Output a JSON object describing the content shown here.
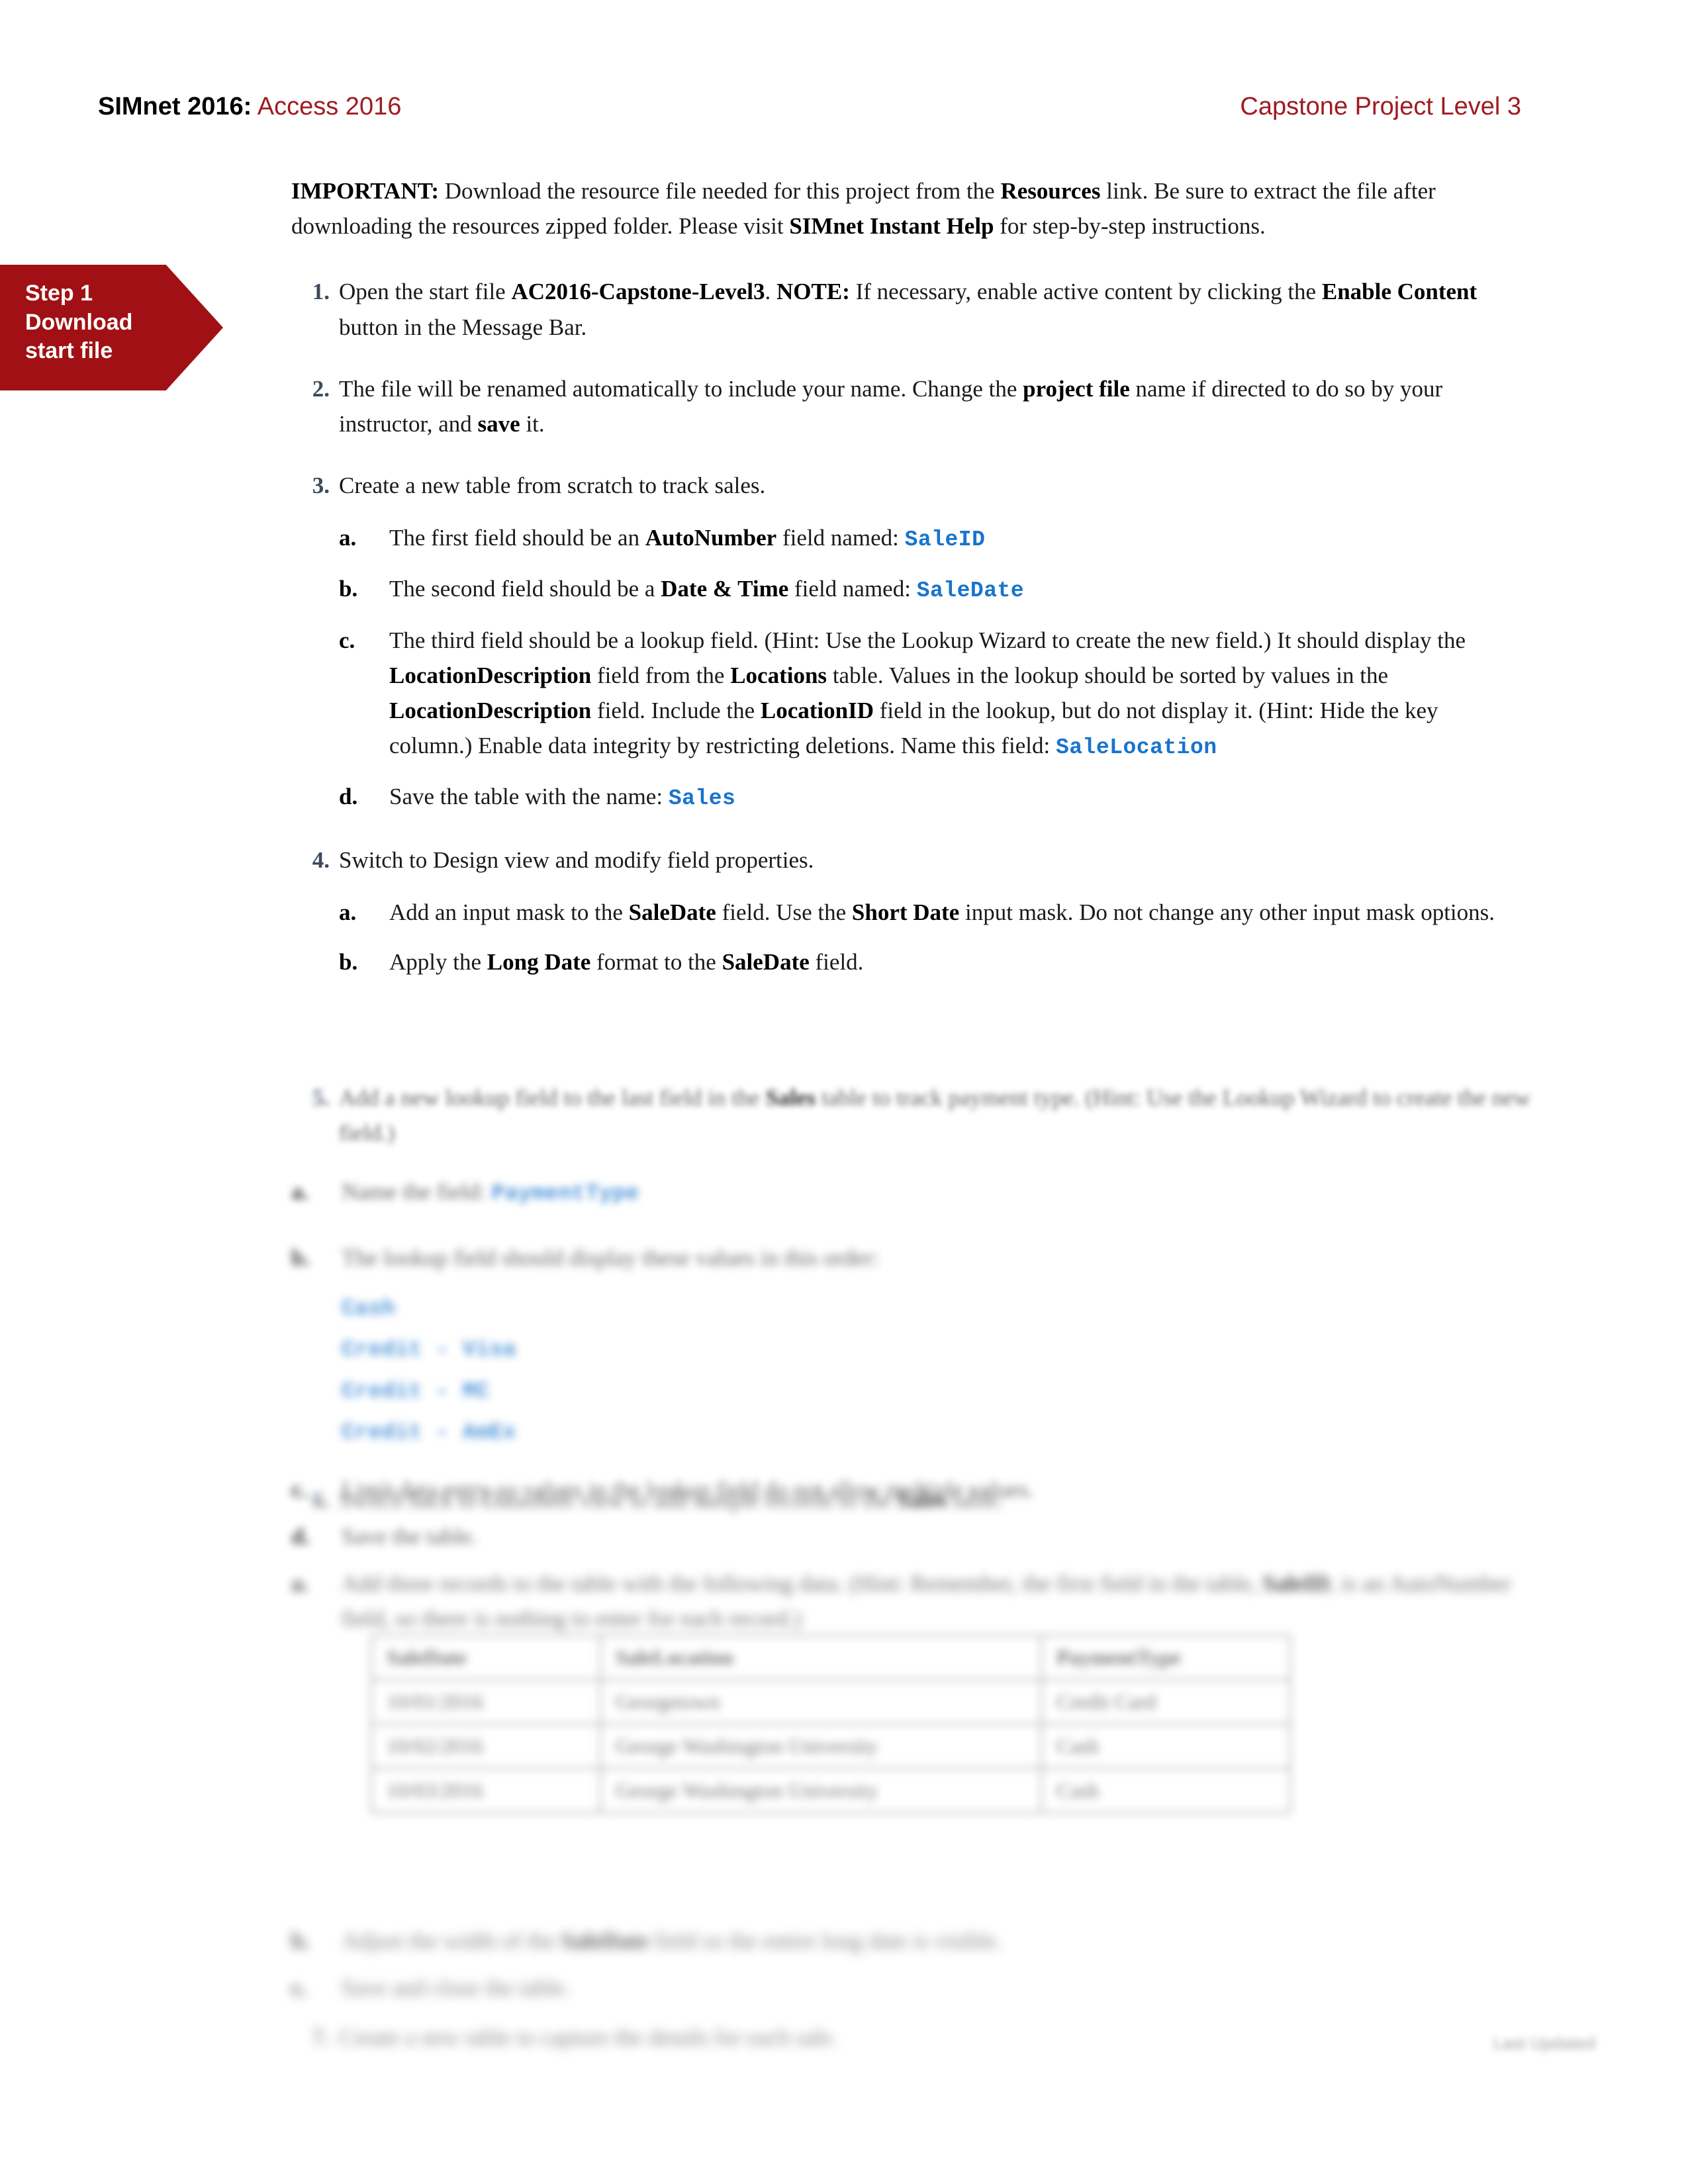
{
  "header": {
    "brand": "SIMnet 2016:",
    "product": " Access 2016",
    "right": "Capstone Project Level 3",
    "brand_color": "#000000",
    "accent_color": "#9E1B20"
  },
  "step_banner": {
    "line1": "Step 1",
    "line2": "Download",
    "line3": "start file",
    "background_color": "#A11014",
    "text_color": "#FFFFFF"
  },
  "important": {
    "label": "IMPORTANT:",
    "text_1": " Download the resource file needed for this project from the ",
    "bold_1": "Resources",
    "text_2": " link. Be sure to extract the file after downloading the resources zipped folder. Please visit ",
    "bold_2": "SIMnet Instant Help",
    "text_3": " for step-by-step instructions."
  },
  "colors": {
    "list_number": "#3D4A5C",
    "field_token": "#1874CD"
  },
  "steps": [
    {
      "marker": "1.",
      "t1": "Open the start file ",
      "b1": "AC2016-Capstone-Level3",
      "t2": ". ",
      "b2": "NOTE:",
      "t3": " If necessary, enable active content by clicking the ",
      "b3": "Enable Content",
      "t4": " button in the Message Bar."
    },
    {
      "marker": "2.",
      "t1": "The file will be renamed automatically to include your name. Change the ",
      "b1": "project file",
      "t2": " name if directed to do so by your instructor, and ",
      "b2": "save",
      "t3": " it."
    },
    {
      "marker": "3.",
      "t1": "Create a new table from scratch to track sales."
    },
    {
      "marker": "4.",
      "t1": "Switch to Design view and modify field properties."
    }
  ],
  "step3_sub": [
    {
      "marker": "a.",
      "t1": "The first field should be an ",
      "b1": "AutoNumber",
      "t2": " field named: ",
      "field": "SaleID"
    },
    {
      "marker": "b.",
      "t1": "The second field should be a ",
      "b1": "Date & Time",
      "t2": " field named: ",
      "field": "SaleDate"
    },
    {
      "marker": "c.",
      "t1": "The third field should be a lookup field. (Hint: Use the Lookup Wizard to create the new field.) It should display the ",
      "b1": "LocationDescription",
      "t2": " field from the ",
      "b2": "Locations",
      "t3": " table. Values in the lookup should be sorted by values in the ",
      "b3": "LocationDescription",
      "t4": " field. Include the ",
      "b4": "LocationID",
      "t5": " field in the lookup, but do not display it. (Hint: Hide the key column.) Enable data integrity by restricting deletions. Name this field: ",
      "field": "SaleLocation"
    },
    {
      "marker": "d.",
      "t1": "Save the table with the name: ",
      "field": "Sales"
    }
  ],
  "step4_sub": [
    {
      "marker": "a.",
      "t1": "Add an input mask to the ",
      "b1": "SaleDate",
      "t2": " field. Use the ",
      "b2": "Short Date",
      "t3": " input mask. Do not change any other input mask options."
    },
    {
      "marker": "b.",
      "t1": "Apply the ",
      "b1": "Long Date",
      "t2": " format to the ",
      "b2": "SaleDate",
      "t3": " field."
    }
  ],
  "obscured": {
    "note": "Content below is blurred/illegible in the source screenshot.",
    "step5": {
      "marker": "5.",
      "t1": "Add a new lookup field to the last field in the ",
      "b1": "Sales",
      "t2": " table to track payment type. (Hint: Use the Lookup Wizard to create the new field.)"
    },
    "step5a": {
      "marker": "a.",
      "t1": "Name the field: ",
      "field": "PaymentType"
    },
    "step5b": {
      "marker": "b.",
      "t1": "The lookup field should display these values in this order:"
    },
    "step5b_values": [
      "Cash",
      "Credit - Visa",
      "Credit - MC",
      "Credit - AmEx"
    ],
    "step5c": {
      "marker": "c.",
      "t1": "Limit data entry so values in the lookup field do not allow multiple values."
    },
    "step5d": {
      "marker": "d.",
      "t1": "Save the table."
    },
    "step6": {
      "marker": "6.",
      "t1": "Switch back to Datasheet view to add sample records to the ",
      "b1": "Sales",
      "t2": " table."
    },
    "step6a": {
      "marker": "a.",
      "t1": "Add three records to the table with the following data. (Hint: Remember, the first field in the table, ",
      "b1": "SaleID",
      "t2": ", is an AutoNumber field, so there is nothing to enter for each record.)"
    },
    "step6b": {
      "marker": "b.",
      "t1": "Adjust the width of the ",
      "b1": "SaleDate",
      "t2": " field so the entire long date is visible."
    },
    "step6c": {
      "marker": "c.",
      "t1": "Save and close the table."
    },
    "step7": {
      "marker": "7.",
      "t1": "Create a new table to capture the details for each sale."
    }
  },
  "sample_table": {
    "headers": [
      "SaleDate",
      "SaleLocation",
      "PaymentType"
    ],
    "rows": [
      [
        "10/01/2016",
        "Georgetown",
        "Credit Card"
      ],
      [
        "10/02/2016",
        "George Washington University",
        "Cash"
      ],
      [
        "10/03/2016",
        "George Washington University",
        "Cash"
      ]
    ]
  },
  "footer": {
    "text": "Last Updated"
  }
}
